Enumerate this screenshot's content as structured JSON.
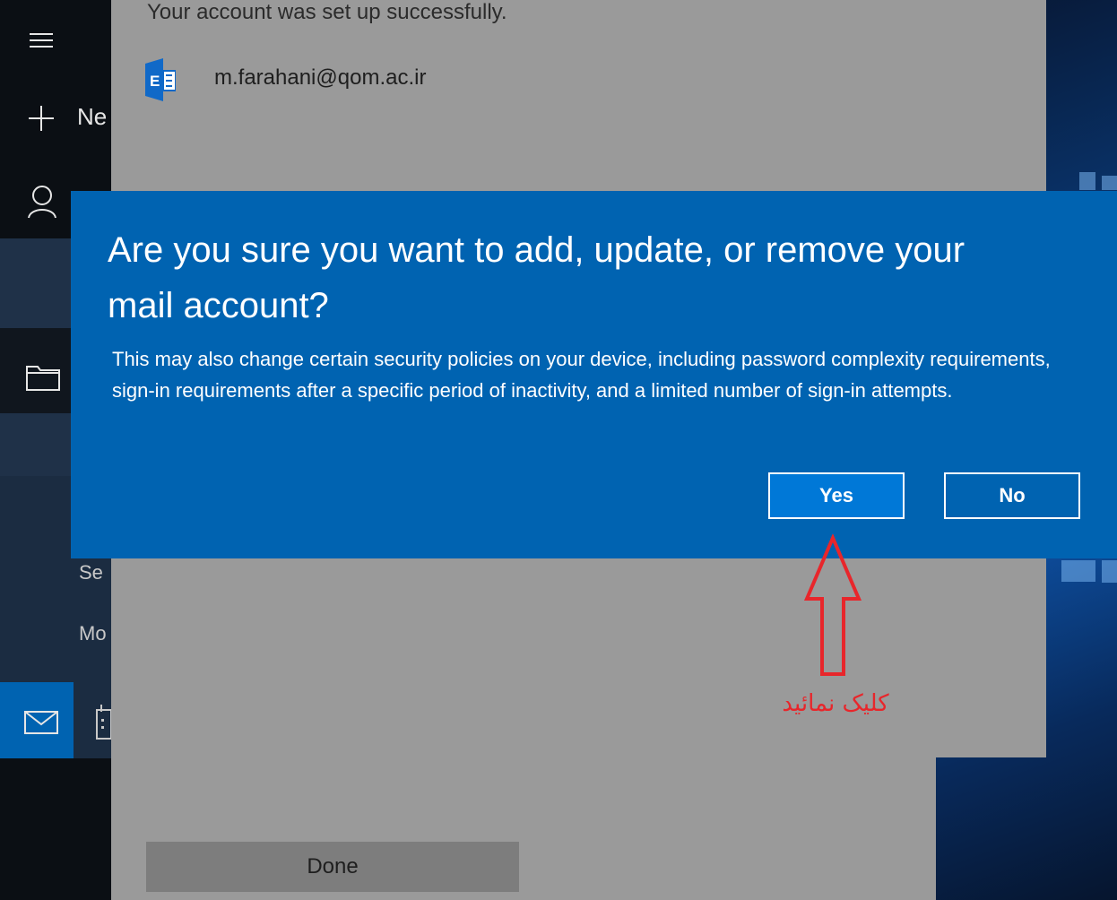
{
  "sidebar": {
    "new_mail_label": "Ne",
    "folder_item_1": "Se",
    "folder_item_2": "Mo"
  },
  "setup": {
    "success_message": "Your account was set up successfully.",
    "account_email": "m.farahani@qom.ac.ir",
    "done_label": "Done"
  },
  "dialog": {
    "title": "Are you sure you want to add, update, or remove your mail account?",
    "body": "This may also change certain security policies on your device, including password complexity requirements, sign-in requirements after a specific period of inactivity, and a limited number of sign-in attempts.",
    "yes_label": "Yes",
    "no_label": "No"
  },
  "annotation": {
    "text": "کلیک نمائید"
  },
  "colors": {
    "dialog_bg": "#0063b1",
    "yes_bg": "#0078d7",
    "annotation": "#e8262b"
  }
}
